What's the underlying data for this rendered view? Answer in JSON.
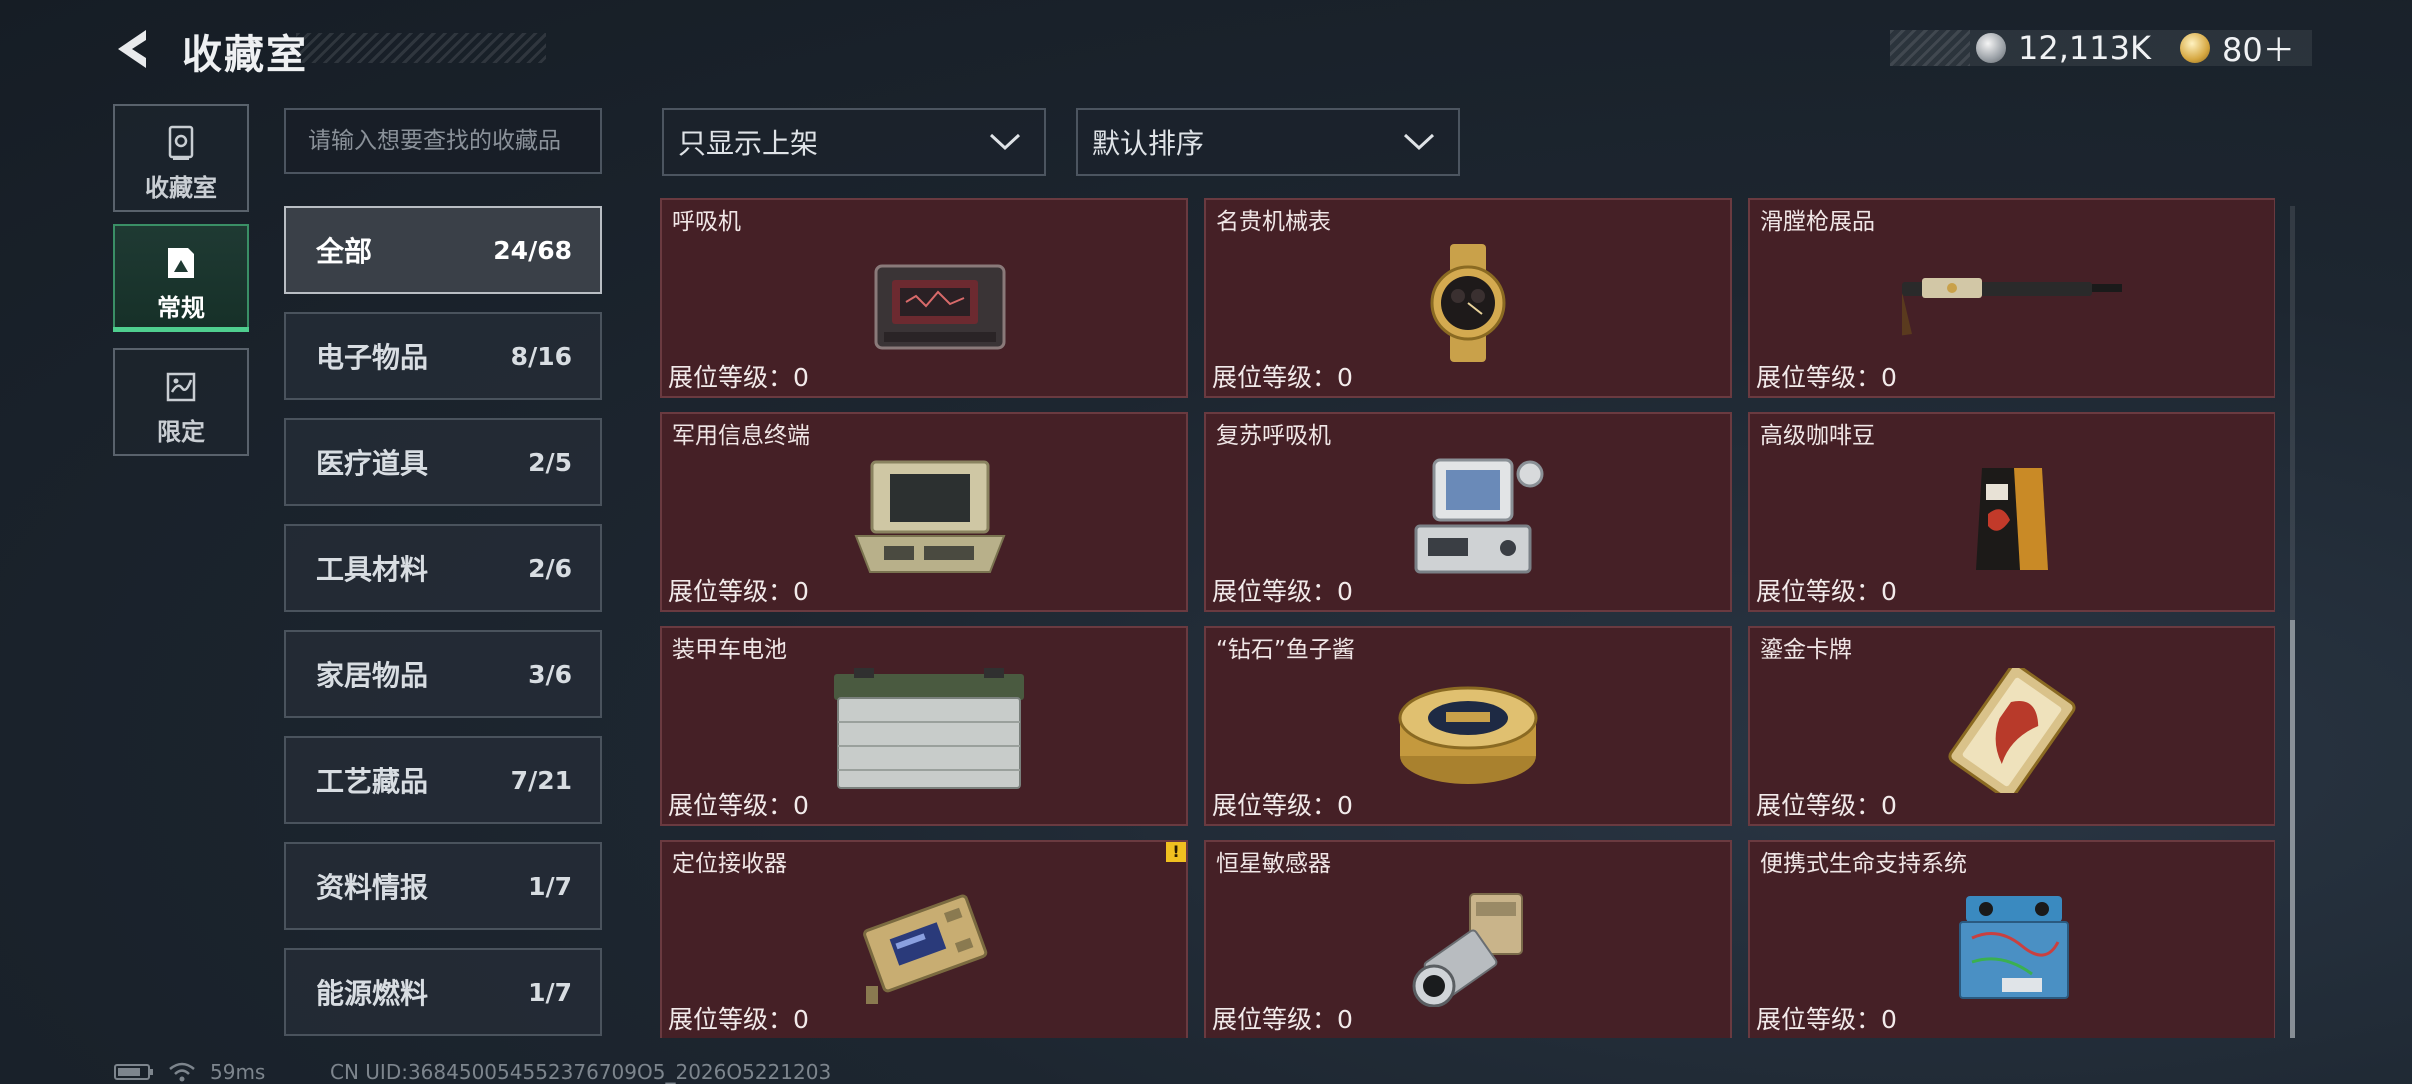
{
  "header": {
    "title": "收藏室",
    "currencies": [
      {
        "icon": "silver-coin-icon",
        "value": "12,113K"
      },
      {
        "icon": "gold-coin-icon",
        "value": "80＋"
      }
    ]
  },
  "rail": {
    "items": [
      {
        "label": "收藏室",
        "icon": "trophy-icon"
      },
      {
        "label": "常规",
        "icon": "exhibit-icon",
        "active": true
      },
      {
        "label": "限定",
        "icon": "map-icon"
      }
    ]
  },
  "search": {
    "placeholder": "请输入想要查找的收藏品"
  },
  "filters": {
    "display": "只显示上架",
    "sort": "默认排序"
  },
  "categories": [
    {
      "name": "全部",
      "count": "24/68",
      "active": true
    },
    {
      "name": "电子物品",
      "count": "8/16"
    },
    {
      "name": "医疗道具",
      "count": "2/5"
    },
    {
      "name": "工具材料",
      "count": "2/6"
    },
    {
      "name": "家居物品",
      "count": "3/6"
    },
    {
      "name": "工艺藏品",
      "count": "7/21"
    },
    {
      "name": "资料情报",
      "count": "1/7"
    },
    {
      "name": "能源燃料",
      "count": "1/7"
    }
  ],
  "level_label": "展位等级：0",
  "items": [
    {
      "name": "呼吸机",
      "icon": "respirator-icon"
    },
    {
      "name": "名贵机械表",
      "icon": "watch-icon"
    },
    {
      "name": "滑膛枪展品",
      "icon": "musket-icon"
    },
    {
      "name": "军用信息终端",
      "icon": "terminal-icon"
    },
    {
      "name": "复苏呼吸机",
      "icon": "resuscitator-icon"
    },
    {
      "name": "高级咖啡豆",
      "icon": "coffee-bag-icon"
    },
    {
      "name": "装甲车电池",
      "icon": "battery-icon"
    },
    {
      "name": "“钻石”鱼子酱",
      "icon": "caviar-tin-icon"
    },
    {
      "name": "鎏金卡牌",
      "icon": "gilded-card-icon"
    },
    {
      "name": "定位接收器",
      "icon": "receiver-icon",
      "warning": "!"
    },
    {
      "name": "恒星敏感器",
      "icon": "star-sensor-icon"
    },
    {
      "name": "便携式生命支持系统",
      "icon": "life-support-icon"
    }
  ],
  "footer": {
    "ping": "59ms",
    "uid": "CN UID:368450054552376709O5_2026O5221203"
  },
  "colors": {
    "card_bg": "#452026",
    "active_green": "#4fcf8f"
  }
}
